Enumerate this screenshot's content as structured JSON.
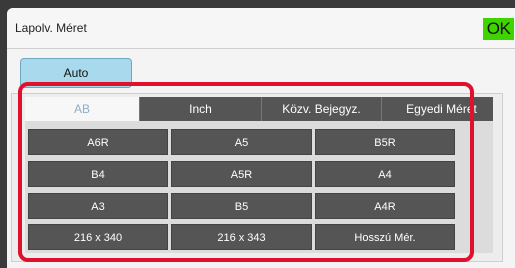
{
  "header": {
    "title": "Lapolv. Méret",
    "ok_label": "OK"
  },
  "auto_label": "Auto",
  "tabs": [
    "AB",
    "Inch",
    "Közv. Bejegyz.",
    "Egyedi Méret"
  ],
  "sizes": [
    [
      "A6R",
      "A5",
      "B5R"
    ],
    [
      "B4",
      "A5R",
      "A4"
    ],
    [
      "A3",
      "B5",
      "A4R"
    ],
    [
      "216 x 340",
      "216 x 343",
      "Hosszú Mér."
    ]
  ],
  "colors": {
    "ok_green": "#3fd400",
    "highlight_red": "#e0102f",
    "auto_blue": "#a8d9ec"
  }
}
